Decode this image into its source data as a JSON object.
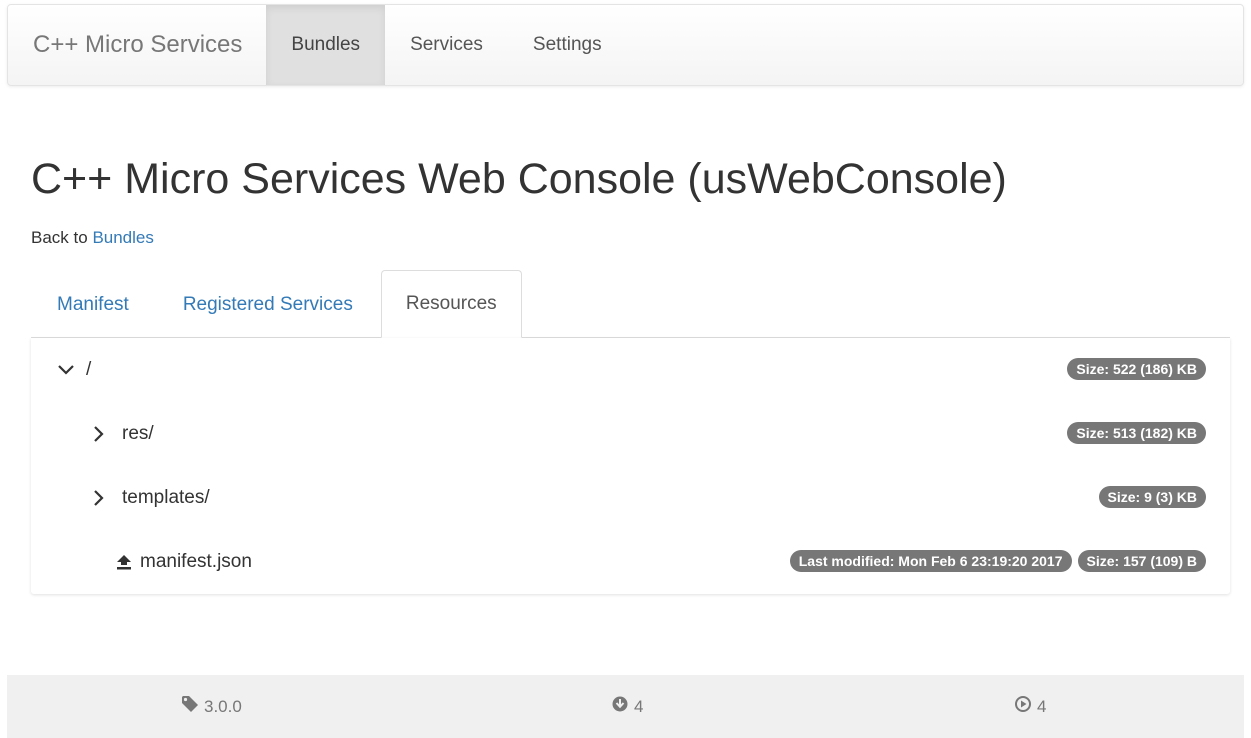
{
  "navbar": {
    "brand": "C++ Micro Services",
    "items": [
      {
        "label": "Bundles",
        "active": true
      },
      {
        "label": "Services",
        "active": false
      },
      {
        "label": "Settings",
        "active": false
      }
    ]
  },
  "page": {
    "title": "C++ Micro Services Web Console (usWebConsole)",
    "back_prefix": "Back to",
    "back_link": "Bundles"
  },
  "tabs": [
    {
      "label": "Manifest",
      "active": false
    },
    {
      "label": "Registered Services",
      "active": false
    },
    {
      "label": "Resources",
      "active": true
    }
  ],
  "tree": {
    "root": {
      "name": "/",
      "icon": "chevron-down-icon",
      "badges": [
        "Size: 522 (186) KB"
      ]
    },
    "children": [
      {
        "name": "res/",
        "icon": "chevron-right-icon",
        "badges": [
          "Size: 513 (182) KB"
        ]
      },
      {
        "name": "templates/",
        "icon": "chevron-right-icon",
        "badges": [
          "Size: 9 (3) KB"
        ]
      },
      {
        "name": "manifest.json",
        "icon": "upload-icon",
        "badges": [
          "Last modified: Mon Feb 6 23:19:20 2017",
          "Size: 157 (109) B"
        ]
      }
    ]
  },
  "footer": {
    "version": "3.0.0",
    "bundles_count": "4",
    "active_count": "4"
  },
  "colors": {
    "link": "#337ab7",
    "badge": "#777777",
    "footer_bg": "#f0f0f0"
  }
}
